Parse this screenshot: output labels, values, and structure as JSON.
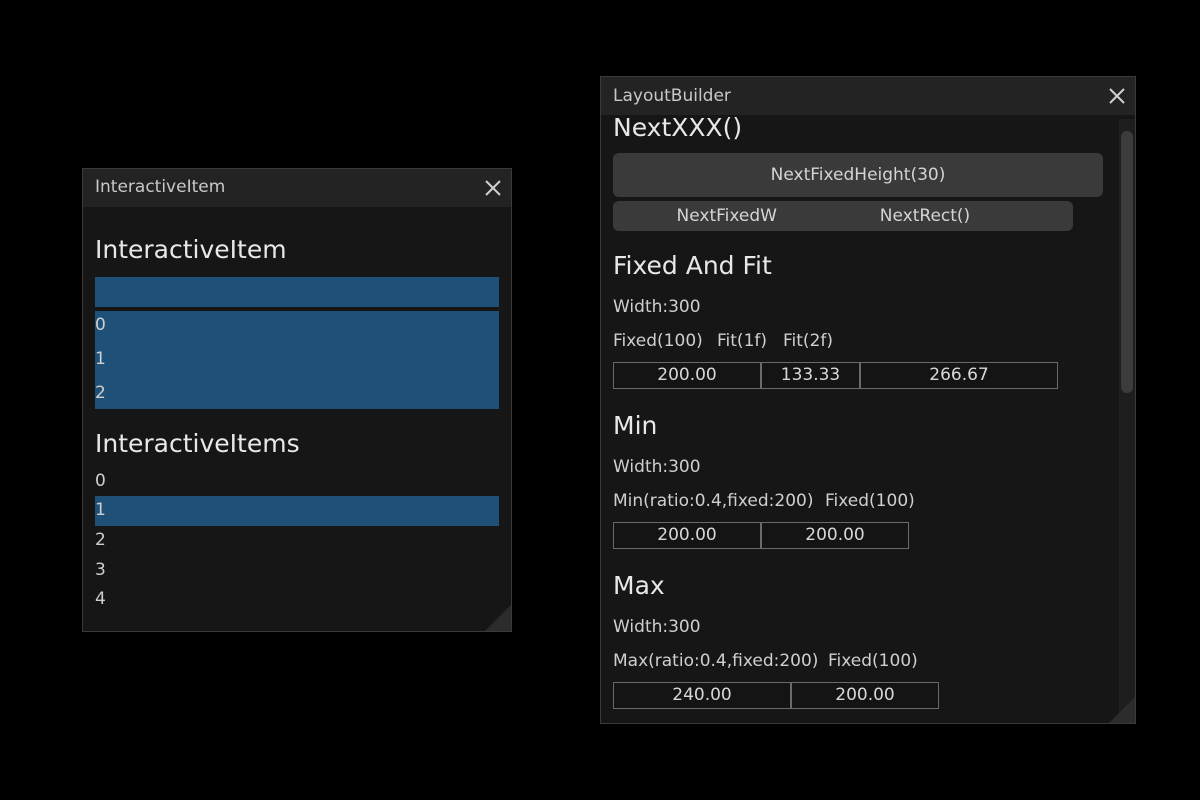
{
  "left_window": {
    "title": "InteractiveItem",
    "heading_single": "InteractiveItem",
    "single_list": [
      "0",
      "1",
      "2"
    ],
    "heading_multi": "InteractiveItems",
    "multi_list": [
      "0",
      "1",
      "2",
      "3",
      "4"
    ],
    "selected_multi_index": 1
  },
  "right_window": {
    "title": "LayoutBuilder",
    "sections": {
      "next": {
        "heading": "NextXXX()",
        "btn_fixed_height": "NextFixedHeight(30)",
        "btn_fixed_width": "NextFixedW",
        "btn_rect": "NextRect()"
      },
      "fixed_fit": {
        "heading": "Fixed And Fit",
        "width": "Width:300",
        "labels": [
          "Fixed(100)",
          "Fit(1f)",
          "Fit(2f)"
        ],
        "values": [
          "200.00",
          "133.33",
          "266.67"
        ]
      },
      "min": {
        "heading": "Min",
        "width": "Width:300",
        "labels": [
          "Min(ratio:0.4,fixed:200)",
          "Fixed(100)"
        ],
        "values": [
          "200.00",
          "200.00"
        ]
      },
      "max": {
        "heading": "Max",
        "width": "Width:300",
        "labels": [
          "Max(ratio:0.4,fixed:200)",
          "Fixed(100)"
        ],
        "values": [
          "240.00",
          "200.00"
        ]
      }
    }
  },
  "colors": {
    "background": "#000000",
    "window": "#161616",
    "titlebar": "#232323",
    "selection": "#1f5078"
  },
  "icons": [
    "close-icon",
    "resize-grip-icon"
  ]
}
